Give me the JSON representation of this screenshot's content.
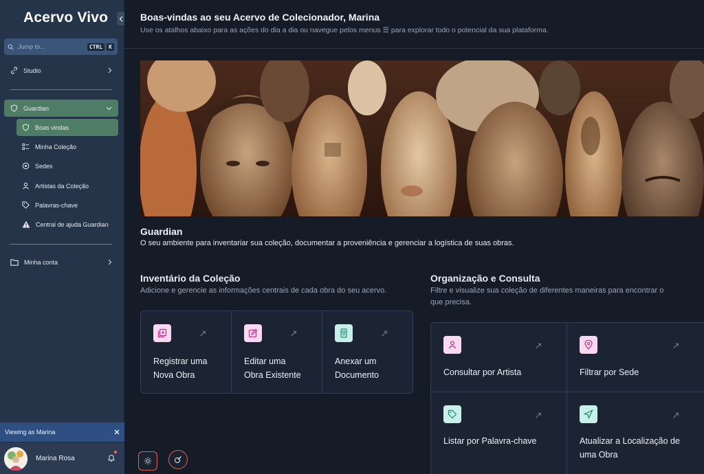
{
  "sidebar": {
    "brand": "Acervo Vivo",
    "search": {
      "placeholder": "Jump to...",
      "kbd_ctrl": "CTRL",
      "kbd_k": "K"
    },
    "studio": "Studio",
    "guardian": "Guardian",
    "guardian_items": [
      {
        "label": "Boas vindas",
        "icon": "shield-icon",
        "active": true
      },
      {
        "label": "Minha Coleção",
        "icon": "list-icon"
      },
      {
        "label": "Sedes",
        "icon": "location-pin-icon"
      },
      {
        "label": "Artistas da Coleção",
        "icon": "user-icon"
      },
      {
        "label": "Palavras-chave",
        "icon": "tag-icon"
      },
      {
        "label": "Central de ajuda Guardian",
        "icon": "warning-icon"
      }
    ],
    "account": "Minha conta",
    "viewing_as": "Viewing as Marina",
    "user_name": "Marina Rosa"
  },
  "header": {
    "title": "Boas-vindas ao seu Acervo de Colecionador, Marina",
    "subtitle": "Use os atalhos abaixo para as ações do dia a dia ou navegue pelos menus ☰ para explorar todo o potencial da sua plataforma."
  },
  "section": {
    "title": "Guardian",
    "description": "O seu ambiente para inventariar sua coleção, documentar a proveniência e gerenciar a logística de suas obras."
  },
  "inventory": {
    "title": "Inventário da Coleção",
    "description": "Adicione e gerencie as informações centrais de cada obra do seu acervo.",
    "cards": [
      {
        "line1": "Registrar uma",
        "line2": "Nova Obra"
      },
      {
        "line1": "Editar uma",
        "line2": "Obra Existente"
      },
      {
        "line1": "Anexar um",
        "line2": "Documento"
      }
    ]
  },
  "organization": {
    "title": "Organização e Consulta",
    "description_line1": "Filtre e visualize sua coleção de diferentes maneiras para encontrar o",
    "description_line2": "que precisa.",
    "cards": [
      {
        "line1": "Consultar por Artista",
        "line2": ""
      },
      {
        "line1": "Filtrar por Sede",
        "line2": ""
      },
      {
        "line1": "Listar por Palavra-chave",
        "line2": ""
      },
      {
        "line1": "Atualizar a Localização de",
        "line2": "uma Obra"
      }
    ]
  },
  "colors": {
    "accent_green": "#4f7c65",
    "sidebar_bg": "#263449",
    "main_bg": "#151c28",
    "pink_icon_bg": "#f8d9ef",
    "teal_icon_bg": "#c9efe9",
    "fab_border": "#e0634e"
  }
}
